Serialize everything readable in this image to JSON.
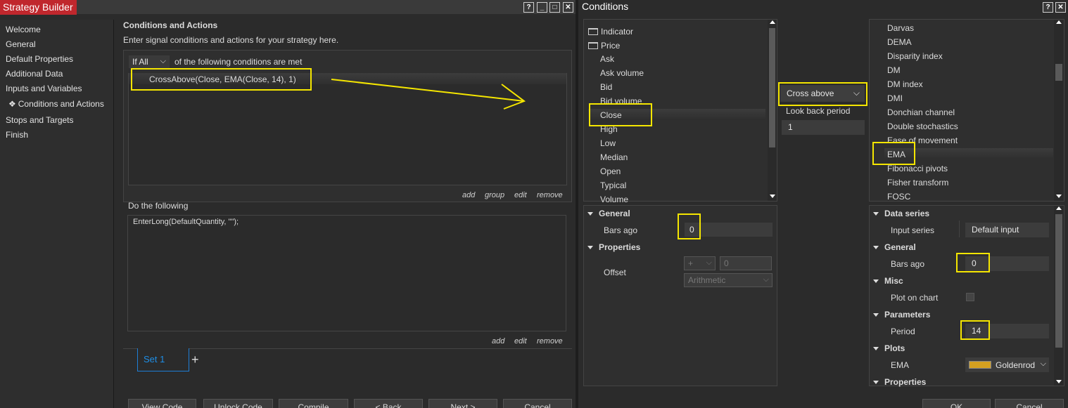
{
  "left_window": {
    "title": "Strategy Builder",
    "controls": [
      "?",
      "_",
      "□",
      "✕"
    ],
    "sidebar": [
      {
        "label": "Welcome"
      },
      {
        "label": "General"
      },
      {
        "label": "Default Properties"
      },
      {
        "label": "Additional Data"
      },
      {
        "label": "Inputs and Variables"
      },
      {
        "label": "Conditions and Actions",
        "selected": true,
        "marker": "❖"
      },
      {
        "label": "Stops and Targets"
      },
      {
        "label": "Finish"
      }
    ],
    "section_title": "Conditions and Actions",
    "section_desc": "Enter signal conditions and actions for your strategy here.",
    "condition_mode": "If All",
    "condition_suffix": "of the following conditions are met",
    "condition_item": "CrossAbove(Close, EMA(Close, 14), 1)",
    "cond_links": [
      "add",
      "group",
      "edit",
      "remove"
    ],
    "do_following": "Do the following",
    "action_item": "EnterLong(DefaultQuantity, \"\");",
    "action_links": [
      "add",
      "edit",
      "remove"
    ],
    "set_tab": "Set 1",
    "add_set": "+",
    "bottom_buttons": [
      "View Code",
      "Unlock Code",
      "Compile",
      "< Back",
      "Next >",
      "Cancel"
    ]
  },
  "right_window": {
    "title": "Conditions",
    "controls": [
      "?",
      "✕"
    ],
    "left_tree": {
      "folders": [
        "Indicator",
        "Price"
      ],
      "items": [
        "Ask",
        "Ask volume",
        "Bid",
        "Bid volume",
        "Close",
        "High",
        "Low",
        "Median",
        "Open",
        "Typical",
        "Volume"
      ],
      "selected": "Close"
    },
    "left_props": {
      "general": "General",
      "bars_ago_label": "Bars ago",
      "bars_ago_value": "0",
      "properties": "Properties",
      "offset_label": "Offset",
      "offset_op": "+",
      "offset_value": "0",
      "offset_type": "Arithmetic"
    },
    "operator": "Cross above",
    "lookback_label": "Look back period",
    "lookback_value": "1",
    "right_list": {
      "items": [
        "Darvas",
        "DEMA",
        "Disparity index",
        "DM",
        "DM index",
        "DMI",
        "Donchian channel",
        "Double stochastics",
        "Ease of movement",
        "EMA",
        "Fibonacci pivots",
        "Fisher transform",
        "FOSC"
      ],
      "selected": "EMA"
    },
    "right_props": {
      "data_series": "Data series",
      "input_series_label": "Input series",
      "input_series_value": "Default input",
      "general": "General",
      "bars_ago_label": "Bars ago",
      "bars_ago_value": "0",
      "misc": "Misc",
      "plot_on_chart_label": "Plot on chart",
      "parameters": "Parameters",
      "period_label": "Period",
      "period_value": "14",
      "plots": "Plots",
      "ema_label": "EMA",
      "ema_color": "Goldenrod",
      "ema_swatch": "#d4a020",
      "properties": "Properties"
    },
    "bottom_buttons": [
      "OK",
      "Cancel"
    ]
  },
  "colors": {
    "highlight": "#f5e600",
    "title_tab": "#c0272d",
    "set_tab": "#1e7ed6"
  }
}
